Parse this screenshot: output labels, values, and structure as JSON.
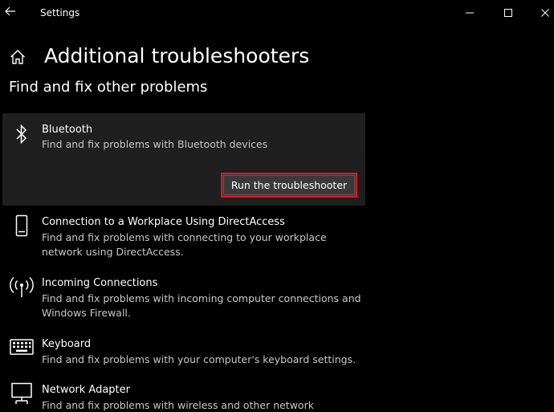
{
  "window": {
    "title": "Settings"
  },
  "page": {
    "title": "Additional troubleshooters",
    "section_title": "Find and fix other problems"
  },
  "troubleshooters": [
    {
      "title": "Bluetooth",
      "description": "Find and fix problems with Bluetooth devices",
      "icon": "bluetooth-icon",
      "expanded": true
    },
    {
      "title": "Connection to a Workplace Using DirectAccess",
      "description": "Find and fix problems with connecting to your workplace network using DirectAccess.",
      "icon": "phone-icon"
    },
    {
      "title": "Incoming Connections",
      "description": "Find and fix problems with incoming computer connections and Windows Firewall.",
      "icon": "antenna-icon"
    },
    {
      "title": "Keyboard",
      "description": "Find and fix problems with your computer's keyboard settings.",
      "icon": "keyboard-icon"
    },
    {
      "title": "Network Adapter",
      "description": "Find and fix problems with wireless and other network adapters.",
      "icon": "network-adapter-icon"
    }
  ],
  "actions": {
    "run_label": "Run the troubleshooter"
  },
  "colors": {
    "background": "#000000",
    "expanded_item_background": "#1f1f1f",
    "button_background": "#3a3a3a",
    "highlight_border": "#e81123",
    "secondary_text": "#c8c8c8"
  }
}
